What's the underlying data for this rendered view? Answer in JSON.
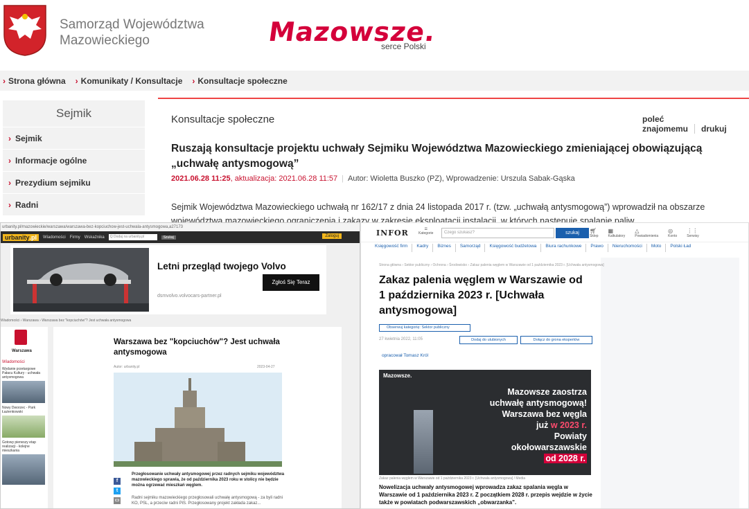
{
  "header": {
    "gov_line1": "Samorząd Województwa",
    "gov_line2": "Mazowieckiego",
    "brand": "Mazowsze.",
    "brand_sub": "serce Polski"
  },
  "breadcrumb": [
    "Strona główna",
    "Komunikaty / Konsultacje",
    "Konsultacje społeczne"
  ],
  "sidebar": {
    "title": "Sejmik",
    "items": [
      {
        "label": "Sejmik"
      },
      {
        "label": "Informacje ogólne"
      },
      {
        "label": "Prezydium sejmiku"
      },
      {
        "label": "Radni"
      }
    ]
  },
  "main": {
    "section_title": "Konsultacje społeczne",
    "recommend": "poleć znajomemu",
    "print": "drukuj",
    "title": "Ruszają konsultacje projektu uchwały Sejmiku Województwa Mazowieckiego zmieniającej obowiązującą „uchwałę antysmogową”",
    "date": "2021.06.28 11:25",
    "update": ", aktualizacja: 2021.06.28 11:57",
    "author": "Autor: Wioletta Buszko (PZ), Wprowadzenie: Urszula Sabak-Gąska",
    "lead": "Sejmik Województwa Mazowieckiego uchwałą nr 162/17 z dnia 24 listopada 2017 r. (tzw. „uchwałą antysmogową”) wprowadził na obszarze województwa mazowieckiego ograniczenia i zakazy w zakresie eksploatacji instalacji, w których następuje spalanie paliw."
  },
  "urbanity": {
    "url": "urbanity.pl/mazowieckie/warszawa/warszawa-bez-kopciuchow-jest-uchwala-antysmogowa,a27173",
    "logo": "urbanity",
    "logo_tld": ".pl",
    "nav": [
      "Wiadomości",
      "Firmy",
      "Wskaźnika"
    ],
    "search": "Q  Dodaj na urbanity.pl",
    "search_btn": "Szukaj",
    "login": "Zaloguj",
    "ad_title": "Letni przegląd twojego Volvo",
    "ad_url": "dsmvolvo.volvocars-partner.pl",
    "ad_button": "Zgłoś Się Teraz",
    "crumb": "Wiadomości  ›  Warszawa  ›  Warszawa bez \"kopciuchów\"? Jest uchwała antysmogowa",
    "side_city": "Warszawa",
    "side_tag": "Wiadomości",
    "side_news": [
      "Wydanie przetargowe Pałacu Kultury - uchwała antysmogowa",
      "Nowy Dworzec - Park Łazienkowski",
      "Gotowy pierwszy etap realizacji - kolejne mieszkania"
    ],
    "article_title": "Warszawa bez \"kopciuchów\"? Jest uchwała antysmogowa",
    "article_author": "Autor: urbanity.pl",
    "article_date": "2023-04-27",
    "caption": "Przegłosowanie uchwały antysmogowej przez radnych sejmiku województwa mazowieckiego sprawia, że od października 2023 roku w stolicy nie będzie można ogrzewać mieszkań węglem.",
    "body": "Radni sejmiku mazowieckiego przegłosowali uchwałę antysmogową - za byli radni KO, PSL, a przeciw radni PiS. Przegłosowany projekt zakłada zakaz..."
  },
  "infor": {
    "logo": "INFOR",
    "categories": "Kategorie",
    "search_placeholder": "Czego szukasz?",
    "search_btn": "szukaj",
    "icons": [
      "Sklep",
      "Kalkulatory",
      "Powiadomienia",
      "Konto",
      "Serwisy"
    ],
    "menu": [
      "Księgowość firm",
      "Kadry",
      "Biznes",
      "Samorząd",
      "Księgowość budżetowa",
      "Biura rachunkowe",
      "Prawo",
      "Nieruchomości",
      "Moto",
      "Polski Ład"
    ],
    "crumb": "Strona główna › Sektor publiczny › Ochrona › Środowisko › Zakaz palenia węglem w Warszawie od 1 października 2023 r. [Uchwała antysmogowa]",
    "title": "Zakaz palenia węglem w Warszawie od 1 października 2023 r. [Uchwała antysmogowa]",
    "category": "Obserwuj kategorię: Sektor publiczny",
    "date": "27 kwietnia 2022, 11:05",
    "favorites": "Dodaj do ulubionych",
    "experts": "Dołącz do grona ekspertów",
    "author": "opracował Tomasz Król",
    "banner_logo": "Mazowsze.",
    "banner_l1": "Mazowsze zaostrza",
    "banner_l2": "uchwałę antysmogową!",
    "banner_l3": "Warszawa bez węgla",
    "banner_l4a": "już ",
    "banner_l4b": "w 2023 r.",
    "banner_l5": "Powiaty",
    "banner_l6": "okołowarszawskie",
    "banner_l7": "od 2028 r.",
    "credit": "Zakaz palenia węglem w Warszawie od 1 października 2023 r. [Uchwała antysmogowa] / Media",
    "lead": "Nowelizacja uchwały antysmogowej wprowadza zakaz spalania węgla w Warszawie od 1 października 2023 r. Z początkiem 2028 r. przepis wejdzie w życie także w powiatach podwarszawskich „obwarzanka”."
  }
}
